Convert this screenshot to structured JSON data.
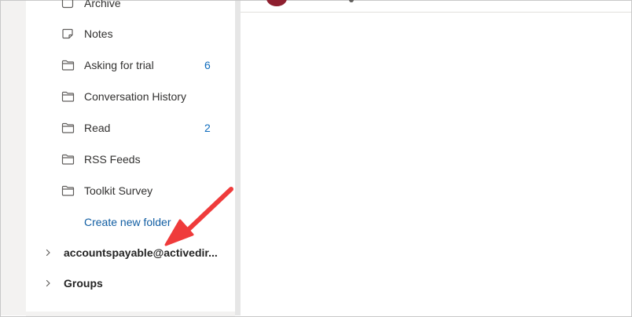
{
  "sidebar": {
    "folders": [
      {
        "label": "Archive",
        "count": "",
        "icon": "archive-icon"
      },
      {
        "label": "Notes",
        "count": "",
        "icon": "note-icon"
      },
      {
        "label": "Asking for trial",
        "count": "6",
        "icon": "folder-icon"
      },
      {
        "label": "Conversation History",
        "count": "",
        "icon": "folder-icon"
      },
      {
        "label": "Read",
        "count": "2",
        "icon": "folder-icon"
      },
      {
        "label": "RSS Feeds",
        "count": "",
        "icon": "folder-icon"
      },
      {
        "label": "Toolkit Survey",
        "count": "",
        "icon": "folder-icon"
      }
    ],
    "create_folder_label": "Create new folder",
    "account_label": "accountspayable@activedir...",
    "groups_label": "Groups"
  },
  "colors": {
    "accent": "#0f6cbd",
    "link": "#115ea3",
    "annotation_arrow": "#ef3b3b",
    "avatar": "#8e1f2f"
  }
}
